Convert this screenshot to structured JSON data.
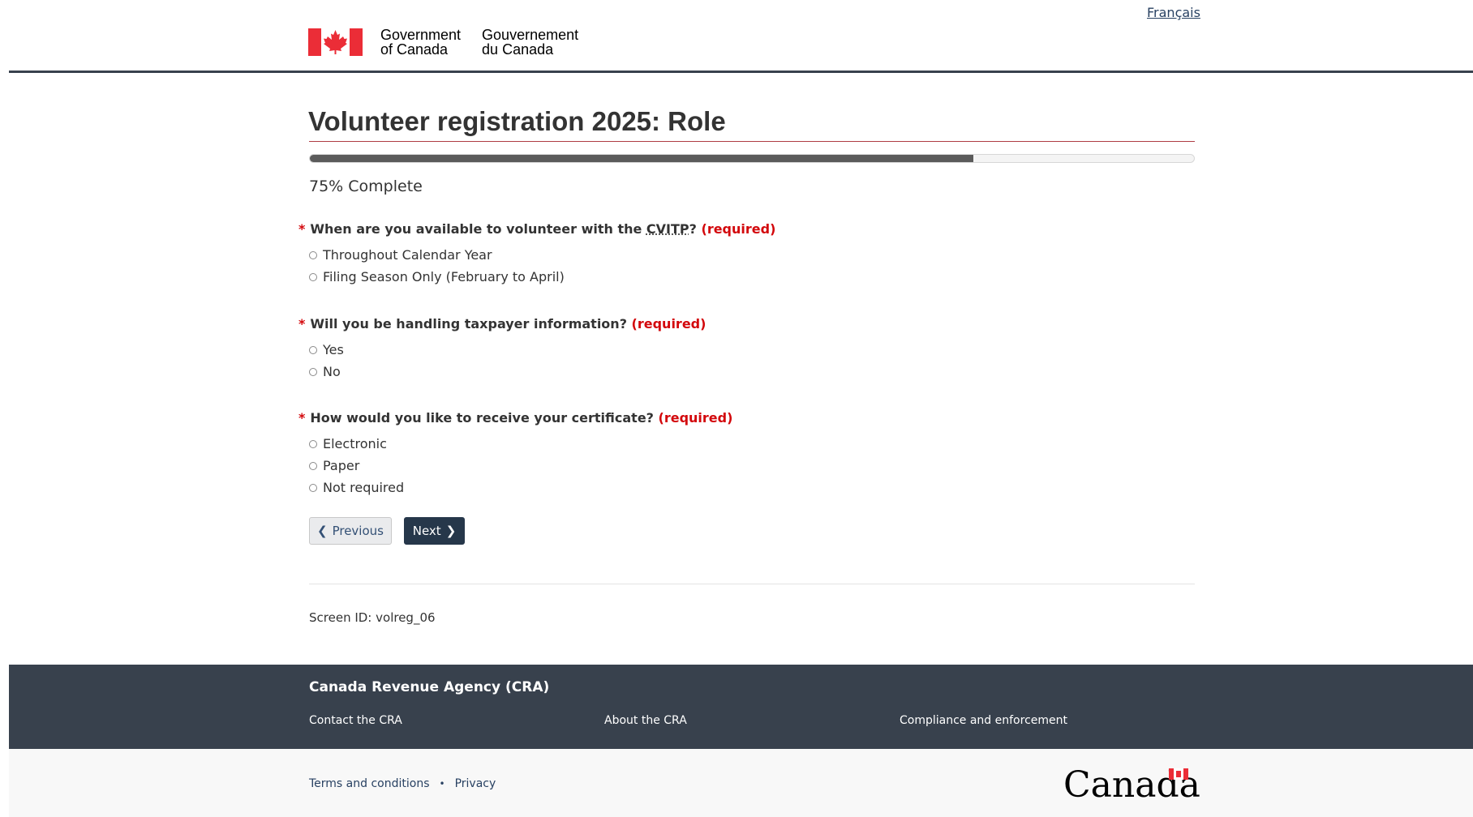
{
  "header": {
    "language_link": "Français",
    "signature_en_line1": "Government",
    "signature_en_line2": "of Canada",
    "signature_fr_line1": "Gouvernement",
    "signature_fr_line2": "du Canada",
    "flag_icon": "canada-flag-icon"
  },
  "main": {
    "title": "Volunteer registration 2025: Role",
    "progress": {
      "percent": 75,
      "label": "75% Complete"
    },
    "questions": [
      {
        "prefix": "When are you available to volunteer with the ",
        "abbr": "CVITP",
        "suffix": "?",
        "required": "(required)",
        "options": [
          "Throughout Calendar Year",
          "Filing Season Only (February to April)"
        ]
      },
      {
        "prefix": "Will you be handling taxpayer information?",
        "required": "(required)",
        "options": [
          "Yes",
          "No"
        ]
      },
      {
        "prefix": "How would you like to receive your certificate?",
        "required": "(required)",
        "options": [
          "Electronic",
          "Paper",
          "Not required"
        ]
      }
    ],
    "required_marker": "*",
    "buttons": {
      "previous": "Previous",
      "next": "Next"
    },
    "screen_id": "Screen ID: volreg_06"
  },
  "footer": {
    "title": "Canada Revenue Agency (CRA)",
    "links": [
      "Contact the CRA",
      "About the CRA",
      "Compliance and enforcement"
    ],
    "sub_links": [
      "Terms and conditions",
      "Privacy"
    ],
    "separator": "•",
    "wordmark": "Canada"
  },
  "colors": {
    "accent_red": "#d3080c",
    "flag_red": "#eb2d37",
    "footer_bg": "#38414d",
    "button_dark": "#26374a"
  }
}
